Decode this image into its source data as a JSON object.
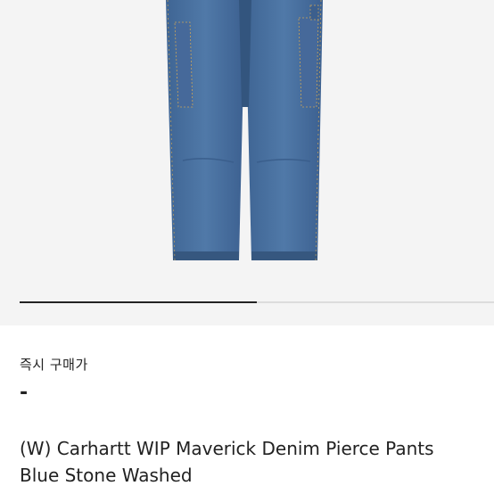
{
  "product": {
    "image_alt": "Blue Stone Washed denim pants",
    "carousel_progress": 0.5,
    "price_label": "즉시 구매가",
    "price_value": "-",
    "title_line1": "(W) Carhartt WIP Maverick Denim Pierce Pants",
    "title_line2": "Blue Stone Washed"
  },
  "colors": {
    "image_bg": "#f4f4f4",
    "denim": "#4b6f9c",
    "denim_dark": "#36577f",
    "stitch": "#c9a45a",
    "text": "#222222"
  }
}
